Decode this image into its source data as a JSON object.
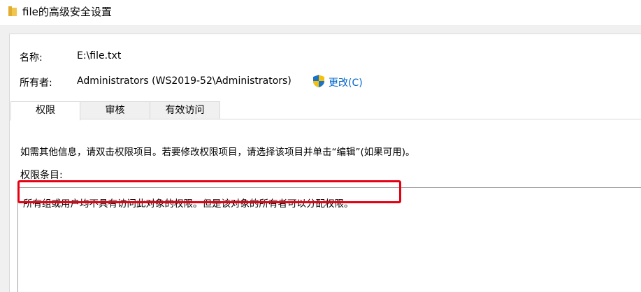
{
  "window": {
    "title": "file的高级安全设置",
    "icon": "folder-icon",
    "accent_color": "#f0c550"
  },
  "info": {
    "name_label": "名称:",
    "name_value": "E:\\file.txt",
    "owner_label": "所有者:",
    "owner_value": "Administrators (WS2019-52\\Administrators)",
    "owner_change_icon": "uac-shield-icon",
    "owner_change_link": "更改(C)",
    "link_color": "#0066cc"
  },
  "tabs": [
    {
      "label": "权限",
      "active": true
    },
    {
      "label": "审核",
      "active": false
    },
    {
      "label": "有效访问",
      "active": false
    }
  ],
  "permissions": {
    "info_text": "如需其他信息，请双击权限项目。若要修改权限项目，请选择该项目并单击“编辑”(如果可用)。",
    "entries_label": "权限条目:",
    "empty_message": "所有组或用户均不具有访问此对象的权限。但是该对象的所有者可以分配权限。",
    "highlight_color": "#e60012"
  }
}
